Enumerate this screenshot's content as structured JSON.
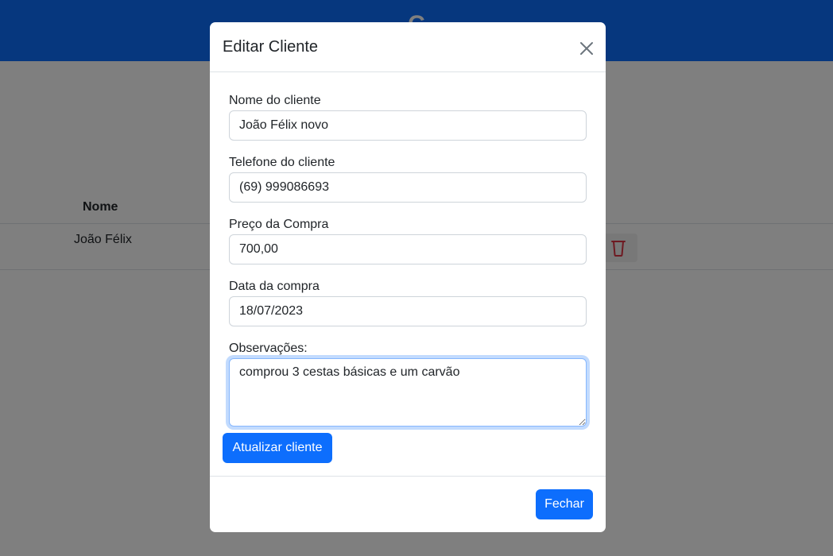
{
  "page": {
    "header_title": "C"
  },
  "table": {
    "header_nome": "Nome",
    "rows": [
      {
        "nome": "João Félix"
      }
    ]
  },
  "modal": {
    "title": "Editar Cliente",
    "fields": {
      "nome": {
        "label": "Nome do cliente",
        "value": "João Félix novo"
      },
      "telefone": {
        "label": "Telefone do cliente",
        "value": "(69) 999086693"
      },
      "preco": {
        "label": "Preço da Compra",
        "value": "700,00"
      },
      "data": {
        "label": "Data da compra",
        "value": "18/07/2023"
      },
      "observacoes": {
        "label": "Observações:",
        "value": "comprou 3 cestas básicas e um carvão"
      }
    },
    "update_button": "Atualizar cliente",
    "close_button": "Fechar"
  },
  "colors": {
    "primary": "#0d6efd",
    "danger": "#dc3545",
    "backdrop": "rgba(0,0,0,0.5)"
  },
  "icons": {
    "close": "close-icon",
    "delete": "trash-icon"
  }
}
